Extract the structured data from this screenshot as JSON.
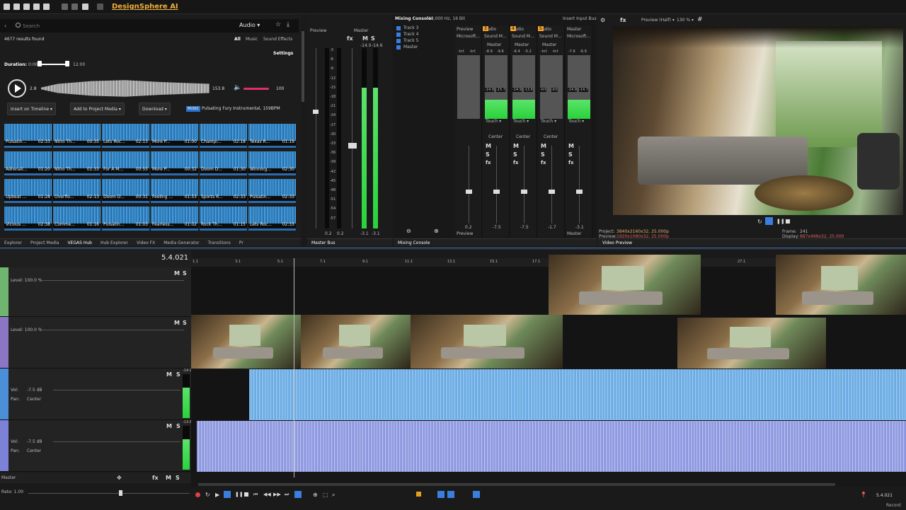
{
  "app": {
    "brand": "DesignSphere AI"
  },
  "explorer": {
    "search_placeholder": "Search",
    "category": "Audio",
    "results": "4677 results found",
    "filters": [
      "All",
      "Music",
      "Sound Effects"
    ],
    "settings": "Settings",
    "duration_label": "Duration:",
    "duration_min": "0:00",
    "duration_max": "12:00",
    "player": {
      "start": "2.8",
      "end": "153.8",
      "volume": "100"
    },
    "actions": {
      "insert": "Insert on Timeline",
      "add": "Add to Project Media",
      "download": "Download"
    },
    "music_tag": "MUSIC",
    "now_playing": "Pulsating Fury Instrumental, 159BPM",
    "tiles": [
      {
        "name": "Pulsatin...",
        "dur": "02:33"
      },
      {
        "name": "Nitro Th...",
        "dur": "00:35"
      },
      {
        "name": "Lets Roc...",
        "dur": "02:13"
      },
      {
        "name": "More P...",
        "dur": "01:00"
      },
      {
        "name": "Champi...",
        "dur": "02:18"
      },
      {
        "name": "Texas R...",
        "dur": "01:19"
      },
      {
        "name": "Adrenali...",
        "dur": "01:20"
      },
      {
        "name": "Nitro Th...",
        "dur": "01:33"
      },
      {
        "name": "For A M...",
        "dur": "00:55"
      },
      {
        "name": "More P...",
        "dur": "00:32"
      },
      {
        "name": "Doom D...",
        "dur": "01:30"
      },
      {
        "name": "Winning...",
        "dur": "02:30"
      },
      {
        "name": "Upbeat ...",
        "dur": "01:28"
      },
      {
        "name": "Overflo...",
        "dur": "02:13"
      },
      {
        "name": "Doom D...",
        "dur": "00:31"
      },
      {
        "name": "Feeling ...",
        "dur": "01:53"
      },
      {
        "name": "Sports R...",
        "dur": "02:33"
      },
      {
        "name": "Pulsatin...",
        "dur": "02:33"
      },
      {
        "name": "Vicious ...",
        "dur": "02:38"
      },
      {
        "name": "Comme...",
        "dur": "01:16"
      },
      {
        "name": "Pulsatin...",
        "dur": "01:03"
      },
      {
        "name": "Fearless...",
        "dur": "01:02"
      },
      {
        "name": "Rock Th...",
        "dur": "01:15"
      },
      {
        "name": "Lets Roc...",
        "dur": "02:33"
      }
    ],
    "tabs": [
      "Explorer",
      "Project Media",
      "VEGAS Hub",
      "Hub Explorer",
      "Video FX",
      "Media Generator",
      "Transitions",
      "Pr"
    ]
  },
  "preview_meter": {
    "label": "Preview",
    "master": "Master",
    "scale": [
      "3",
      "6",
      "9",
      "12",
      "15",
      "18",
      "21",
      "24",
      "27",
      "30",
      "33",
      "36",
      "39",
      "42",
      "45",
      "48",
      "51",
      "54",
      "57"
    ],
    "left_peak": "-14.0",
    "right_peak": "-14.6",
    "bottom": [
      "0.2",
      "0.2",
      "-3.1",
      "-3.1"
    ],
    "level": 0.78
  },
  "master_bus": {
    "tab": "Master Bus"
  },
  "mixing_console": {
    "title": "Mixing Console:",
    "format": "48,000 Hz, 16 Bit",
    "tracks": [
      "Track 3",
      "Track 4",
      "Track 5",
      "Master"
    ],
    "insert": "Insert Input Bus",
    "tab": "Mixing Console",
    "strips": [
      {
        "head": "Preview",
        "name": "Microsoft...",
        "peaks": [
          "-Inf.",
          "-Inf."
        ],
        "bottom": "0.2",
        "label": "Preview"
      },
      {
        "head": "Audio",
        "num": "3",
        "name": "Sound M...",
        "route": "Master",
        "peaks": [
          "-8.9",
          "-9.6"
        ],
        "db": [
          "-14.9",
          "-15.7"
        ],
        "mode": "Touch",
        "pan": "Center",
        "bottom": "-7.5"
      },
      {
        "head": "Audio",
        "num": "4",
        "name": "Sound M...",
        "route": "Master",
        "peaks": [
          "-6.4",
          "-5.2"
        ],
        "db": [
          "-14.9",
          "-13.6"
        ],
        "mode": "Touch",
        "pan": "Center",
        "bottom": "-7.5"
      },
      {
        "head": "Audio",
        "num": "5",
        "name": "Sound M...",
        "route": "Master",
        "peaks": [
          "-Inf.",
          "-Inf."
        ],
        "db": [
          "-Inf.",
          "-Inf."
        ],
        "mode": "Touch",
        "pan": "Center",
        "bottom": "-1.7"
      },
      {
        "head": "Master",
        "name": "Microsoft...",
        "peaks": [
          "-7.6",
          "-6.9"
        ],
        "db": [
          "-14.9",
          "-14.7"
        ],
        "mode": "Touch",
        "bottom": "-3.1",
        "label": "Master"
      }
    ]
  },
  "video_preview": {
    "mode": "Preview (Half)",
    "zoom": "130 %",
    "project_label": "Project:",
    "project": "3840x2160x32, 25.000p",
    "preview_label": "Preview:",
    "preview": "1920x1080x32, 25.000p",
    "frame_label": "Frame:",
    "frame": "241",
    "display_label": "Display:",
    "display": "887x499x32, 25.000",
    "tab": "Video Preview"
  },
  "timeline": {
    "timecode": "5.4.021",
    "ruler": [
      "1.1",
      "3.1",
      "5.1",
      "7.1",
      "9.1",
      "11.1",
      "13.1",
      "15.1",
      "17.1",
      "27.1"
    ],
    "tracks": [
      {
        "type": "video",
        "level": "Level: 100.0 %"
      },
      {
        "type": "video",
        "level": "Level: 100.0 %"
      },
      {
        "type": "audio",
        "vol": "Vol:",
        "vol_val": "-7.5 dB",
        "pan": "Pan:",
        "pan_val": "Center",
        "peak": "-14.9"
      },
      {
        "type": "audio",
        "vol": "Vol:",
        "vol_val": "-7.5 dB",
        "pan": "Pan:",
        "pan_val": "Center",
        "peak": "-13.6"
      }
    ],
    "master": "Master",
    "rate": "Rate: 1.00",
    "end_time": "5.4.021",
    "record": "Record"
  }
}
